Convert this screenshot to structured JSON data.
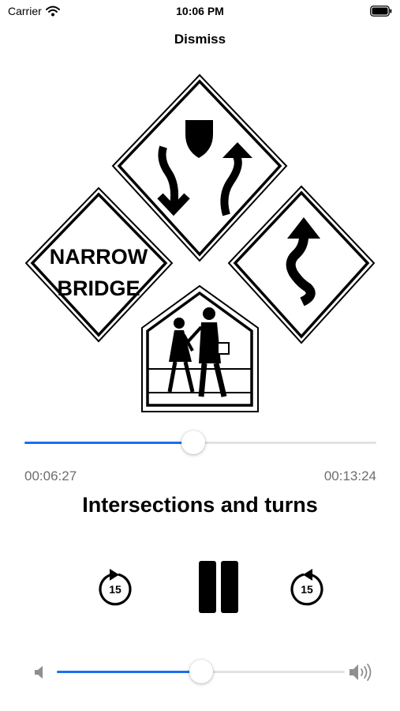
{
  "status_bar": {
    "carrier": "Carrier",
    "time": "10:06 PM"
  },
  "nav": {
    "dismiss_label": "Dismiss"
  },
  "artwork": {
    "signs": [
      "two-way-traffic-sign",
      "narrow-bridge-sign",
      "winding-road-sign",
      "school-crossing-sign"
    ],
    "narrow_bridge_line1": "NARROW",
    "narrow_bridge_line2": "BRIDGE"
  },
  "player": {
    "elapsed": "00:06:27",
    "duration": "00:13:24",
    "progress": 0.48,
    "title": "Intersections and turns",
    "skip_back_seconds": "15",
    "skip_forward_seconds": "15",
    "state": "playing",
    "volume": 0.5
  },
  "colors": {
    "accent": "#1a6ff0",
    "track": "#e2e2e4",
    "secondary_text": "#6d6d72"
  }
}
